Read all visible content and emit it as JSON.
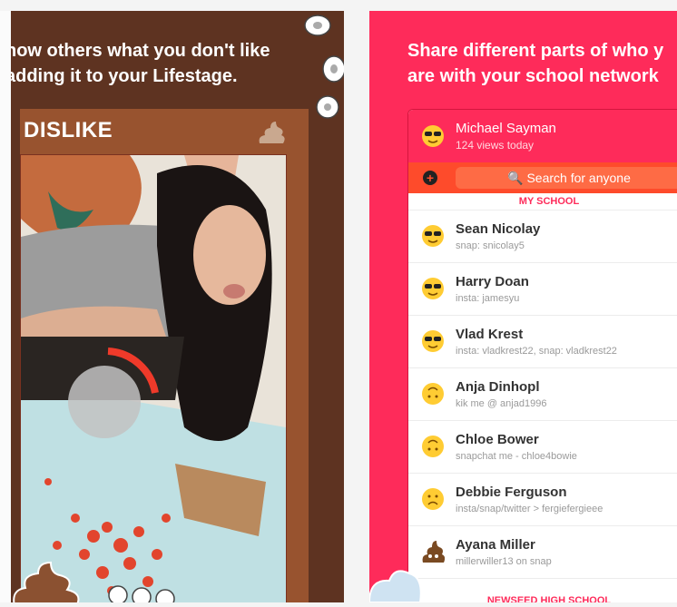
{
  "left_panel": {
    "caption_line1": "how others what you don't like",
    "caption_line2": "adding it to your Lifestage.",
    "card_title": "DISLIKE"
  },
  "right_panel": {
    "caption_line1": "Share different parts of who y",
    "caption_line2": "are with your school network",
    "me": {
      "name": "Michael Sayman",
      "sub": "124 views today"
    },
    "search_placeholder": "Search for anyone",
    "section_my_school": "MY SCHOOL",
    "section_other_school": "NEWSEED HIGH SCHOOL",
    "users": [
      {
        "name": "Sean Nicolay",
        "sub": "snap: snicolay5",
        "icon": "sunglasses-emoji"
      },
      {
        "name": "Harry Doan",
        "sub": "insta: jamesyu",
        "icon": "sunglasses-emoji"
      },
      {
        "name": "Vlad Krest",
        "sub": "insta: vladkrest22, snap: vladkrest22",
        "icon": "sunglasses-emoji"
      },
      {
        "name": "Anja Dinhopl",
        "sub": "kik me @ anjad1996",
        "icon": "upside-down-emoji"
      },
      {
        "name": "Chloe Bower",
        "sub": "snapchat me - chloe4bowie",
        "icon": "upside-down-emoji"
      },
      {
        "name": "Debbie Ferguson",
        "sub": "insta/snap/twitter > fergiefergieee",
        "icon": "frown-emoji"
      },
      {
        "name": "Ayana Miller",
        "sub": "millerwiller13 on snap",
        "icon": "poop-emoji"
      }
    ]
  },
  "colors": {
    "brown_bg": "#5e3321",
    "pink_bg": "#fe2b5a",
    "orange": "#fe4b2b"
  }
}
